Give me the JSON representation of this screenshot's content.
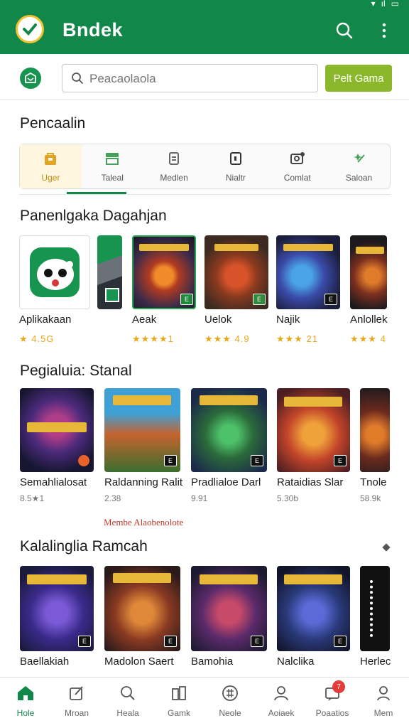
{
  "app": {
    "title": "Bndek"
  },
  "search": {
    "placeholder": "Peacaolaola",
    "cta_label": "Pelt Gama"
  },
  "categories": {
    "title": "Pencaalin",
    "tabs": [
      {
        "label": "Uger",
        "icon": "bag-icon"
      },
      {
        "label": "Taleal",
        "icon": "store-icon"
      },
      {
        "label": "Medlen",
        "icon": "document-icon"
      },
      {
        "label": "Nialtr",
        "icon": "tablet-icon"
      },
      {
        "label": "Comlat",
        "icon": "camera-icon"
      },
      {
        "label": "Saloan",
        "icon": "sparkle-icon"
      }
    ]
  },
  "section1": {
    "title": "Panenlgaka Dagahjan",
    "items": [
      {
        "name": "Aplikakaan",
        "meta": "★ 4.5G"
      },
      {
        "name": "",
        "meta": ""
      },
      {
        "name": "Aeak",
        "meta": "★★★★1"
      },
      {
        "name": "Uelok",
        "meta": "★★★ 4.9"
      },
      {
        "name": "Najik",
        "meta": "★★★ 21"
      },
      {
        "name": "Anlollek",
        "meta": "★★★ 4"
      }
    ]
  },
  "section2": {
    "title": "Pegialuia: Stanal",
    "items": [
      {
        "name": "Semahlialosat",
        "meta": "8.5★1"
      },
      {
        "name": "Raldanning Ralit",
        "meta": "2.38"
      },
      {
        "name": "Pradlialoe Darl",
        "meta": "9.91"
      },
      {
        "name": "Rataidias Slar",
        "meta": "5.30b"
      },
      {
        "name": "Tnole",
        "meta": "58.9k"
      }
    ],
    "promo": "Membe Alaobenolote"
  },
  "section3": {
    "title": "Kalalinglia Ramcah",
    "items": [
      {
        "name": "Baellakiah"
      },
      {
        "name": "Madolon Saert"
      },
      {
        "name": "Bamohia"
      },
      {
        "name": "Nalclika"
      },
      {
        "name": "Herlec"
      }
    ]
  },
  "bottom_nav": [
    {
      "label": "Hole",
      "icon": "home-icon"
    },
    {
      "label": "Mroan",
      "icon": "edit-icon"
    },
    {
      "label": "Heala",
      "icon": "search-icon"
    },
    {
      "label": "Gamk",
      "icon": "library-icon"
    },
    {
      "label": "Neole",
      "icon": "grid-icon"
    },
    {
      "label": "Aoiaek",
      "icon": "people-icon"
    },
    {
      "label": "Poaatios",
      "icon": "notifications-icon",
      "badge": "7"
    },
    {
      "label": "Mem",
      "icon": "profile-icon"
    }
  ],
  "colors": {
    "brand": "#12874a",
    "cta": "#8ab82a",
    "star": "#e8a61c",
    "badge": "#e43b3b"
  }
}
